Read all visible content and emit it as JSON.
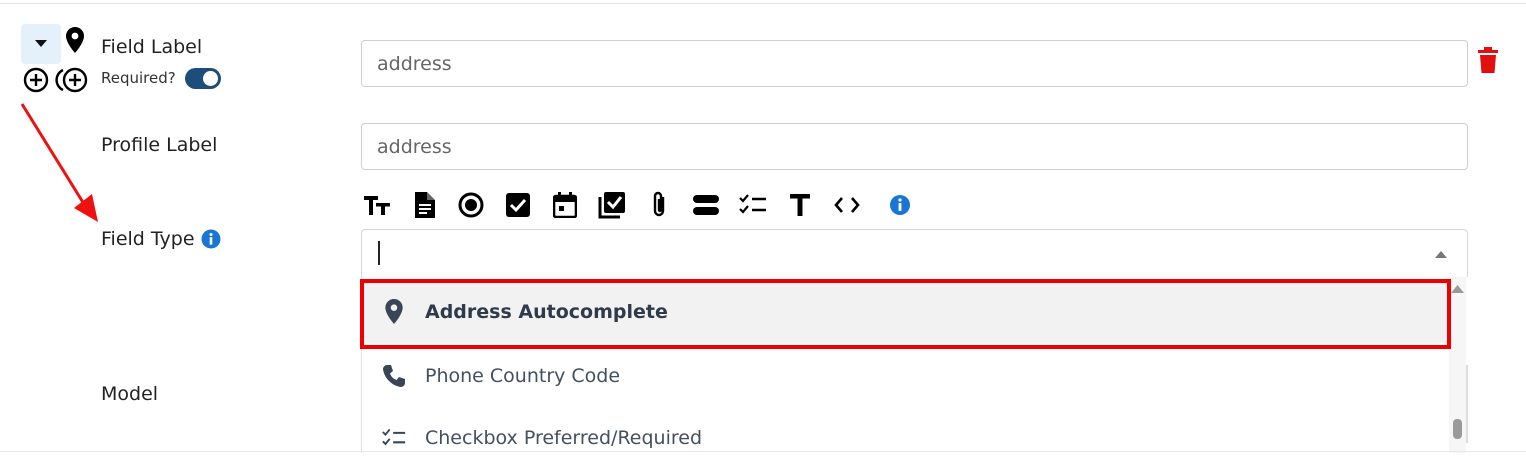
{
  "field_row": {
    "field_label": "Field Label",
    "required_label": "Required?",
    "required_on": true,
    "field_label_value": "address"
  },
  "profile_row": {
    "profile_label": "Profile Label",
    "profile_label_value": "address"
  },
  "type_row": {
    "field_type_label": "Field Type",
    "toolbar_icons": [
      "text-size-icon",
      "document-icon",
      "radio-icon",
      "checkbox-icon",
      "calendar-icon",
      "checklist-box-icon",
      "attachment-icon",
      "toggle-field-icon",
      "checklist-icon",
      "text-icon",
      "code-icon",
      "info-icon"
    ],
    "search_value": "",
    "options": [
      {
        "label": "Address Autocomplete",
        "icon": "map-pin-icon",
        "selected": true
      },
      {
        "label": "Phone Country Code",
        "icon": "phone-icon",
        "selected": false
      },
      {
        "label": "Checkbox Preferred/Required",
        "icon": "checklist-icon",
        "selected": false
      }
    ]
  },
  "model_row": {
    "model_label": "Model"
  },
  "colors": {
    "accent": "#1d4d79",
    "info": "#1976d2",
    "danger": "#e01010",
    "highlight": "#ee0000",
    "collapse_bg": "#e4f1fb"
  }
}
